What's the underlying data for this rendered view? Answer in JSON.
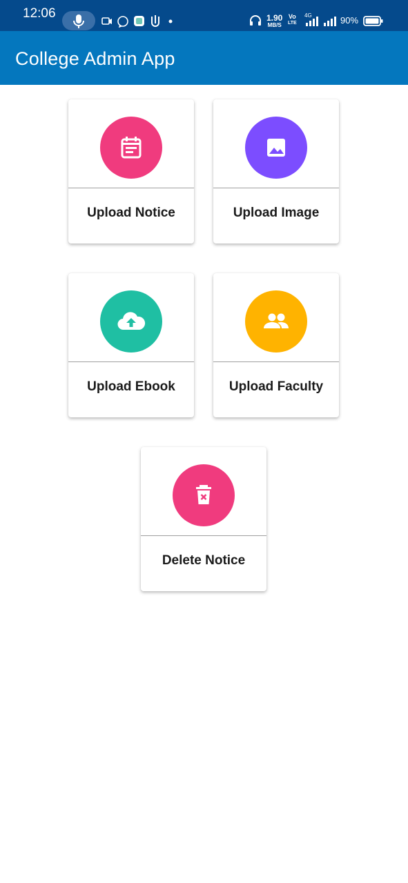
{
  "status_bar": {
    "time": "12:06",
    "net_speed": "1.90",
    "net_unit": "MB/S",
    "volte": "Vo",
    "lte": "LTE",
    "net_type": "4G",
    "battery_percent": "90%"
  },
  "app_bar": {
    "title": "College Admin App"
  },
  "cards": [
    {
      "label": "Upload Notice",
      "icon": "calendar-icon",
      "color": "#f03b7e"
    },
    {
      "label": "Upload Image",
      "icon": "image-icon",
      "color": "#7c4dff"
    },
    {
      "label": "Upload Ebook",
      "icon": "cloud-upload-icon",
      "color": "#1fbfa3"
    },
    {
      "label": "Upload Faculty",
      "icon": "people-icon",
      "color": "#ffb300"
    },
    {
      "label": "Delete Notice",
      "icon": "delete-icon",
      "color": "#f03b7e"
    }
  ]
}
